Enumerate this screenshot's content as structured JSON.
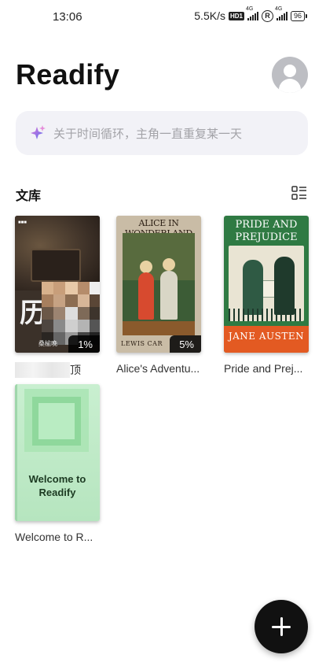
{
  "status_bar": {
    "time": "13:06",
    "net_speed": "5.5K/s",
    "hd_badge": "HD1",
    "network_1": "4G",
    "roaming": "R",
    "network_2": "4G",
    "battery": "96"
  },
  "header": {
    "app_title": "Readify",
    "avatar_icon": "user-avatar-icon"
  },
  "search": {
    "placeholder": "关于时间循环，主角一直重复某一天",
    "icon": "sparkle-icon"
  },
  "library": {
    "section_title": "文库",
    "view_toggle_icon": "list-view-icon",
    "books": [
      {
        "title_visible_part": "顶",
        "progress": "1%",
        "cover_big_text": "历",
        "cover_sub": "桑榆晚"
      },
      {
        "title": "Alice's Adventu...",
        "progress": "5%",
        "cover_header": "ALICE IN WONDERLAND",
        "cover_footer": "LEWIS CAR"
      },
      {
        "title": "Pride and Prej...",
        "cover_title": "PRIDE AND PREJUDICE",
        "cover_author": "JANE AUSTEN"
      },
      {
        "title": "Welcome to R...",
        "cover_text": "Welcome to Readify"
      }
    ]
  },
  "fab": {
    "icon": "plus-icon"
  },
  "colors": {
    "accent": "#111111",
    "search_bg": "#f2f2f7",
    "placeholder": "#a3a3a8"
  }
}
